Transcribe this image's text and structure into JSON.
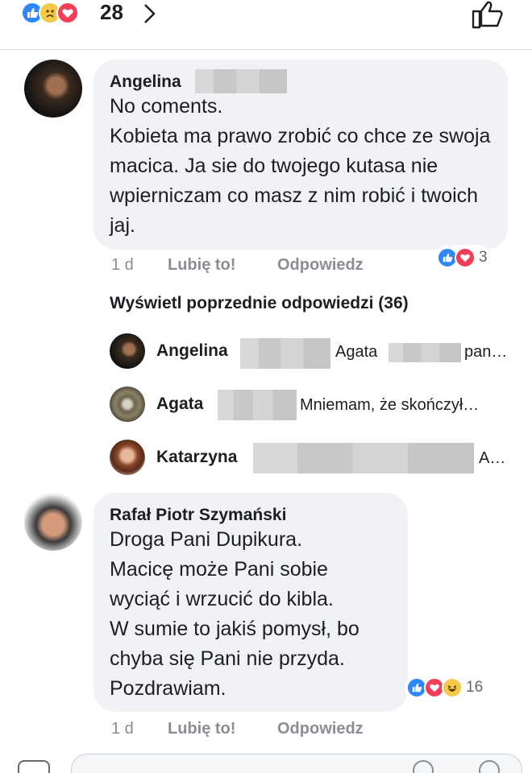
{
  "top": {
    "reactions": [
      "like",
      "sad",
      "love"
    ],
    "count": "28"
  },
  "comment1": {
    "author": "Angelina",
    "text": "No coments.\nKobieta ma prawo zrobić co chce ze swoja macica. Ja sie do twojego kutasa nie wpierniczam co masz z nim robić i twoich jaj.",
    "time": "1 d",
    "like_label": "Lubię to!",
    "reply_label": "Odpowiedz",
    "reactions": [
      "like",
      "love"
    ],
    "reaction_count": "3"
  },
  "previous_replies": "Wyświetl poprzednie odpowiedzi (36)",
  "replies": [
    {
      "name": "Angelina",
      "snippet": "Agata",
      "snippet_end": "pan…"
    },
    {
      "name": "Agata",
      "snippet": "Mniemam, że skończył…"
    },
    {
      "name": "Katarzyna",
      "snippet": "A…"
    }
  ],
  "comment2": {
    "author": "Rafał Piotr Szymański",
    "text": "Droga Pani Dupikura.\nMacicę może Pani sobie wyciąć i wrzucić do kibla.\nW sumie to jakiś pomysł, bo chyba się Pani nie przyda. Pozdrawiam.",
    "time": "1 d",
    "like_label": "Lubię to!",
    "reply_label": "Odpowiedz",
    "reactions": [
      "like",
      "love",
      "haha"
    ],
    "reaction_count": "16"
  },
  "colors": {
    "like": "#2d88ff",
    "love": "#f33e58",
    "sad": "#f7c948",
    "bubble": "#f0f2f5",
    "meta": "#8a8d91"
  }
}
